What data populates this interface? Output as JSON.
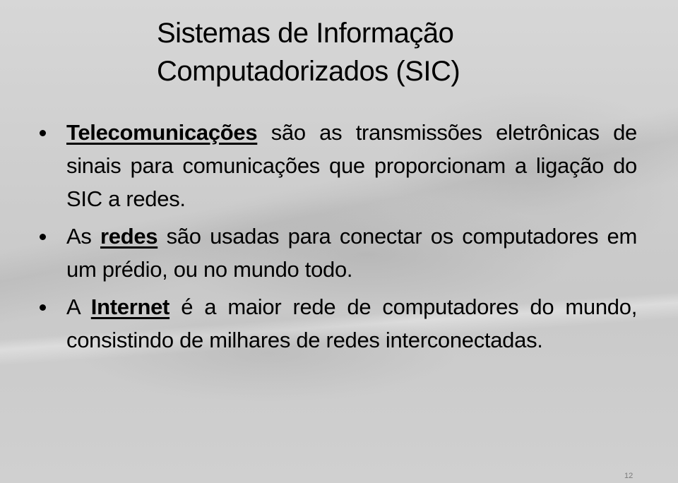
{
  "slide": {
    "title_line1": "Sistemas de Informação",
    "title_line2": "Computadorizados (SIC)",
    "bullets": [
      {
        "keyword": "Telecomunicações",
        "before": "",
        "after": " são as transmissões eletrônicas de sinais para comunicações que proporcionam a ligação do SIC a redes."
      },
      {
        "before": "As ",
        "keyword": "redes",
        "after": " são usadas para conectar os computadores em um prédio, ou no mundo todo."
      },
      {
        "before": "A ",
        "keyword": "Internet",
        "after": " é a maior rede de computadores do mundo, consistindo de milhares de redes interconectadas."
      }
    ],
    "page_number": "12",
    "bullet_icon": "bullet-dot"
  }
}
